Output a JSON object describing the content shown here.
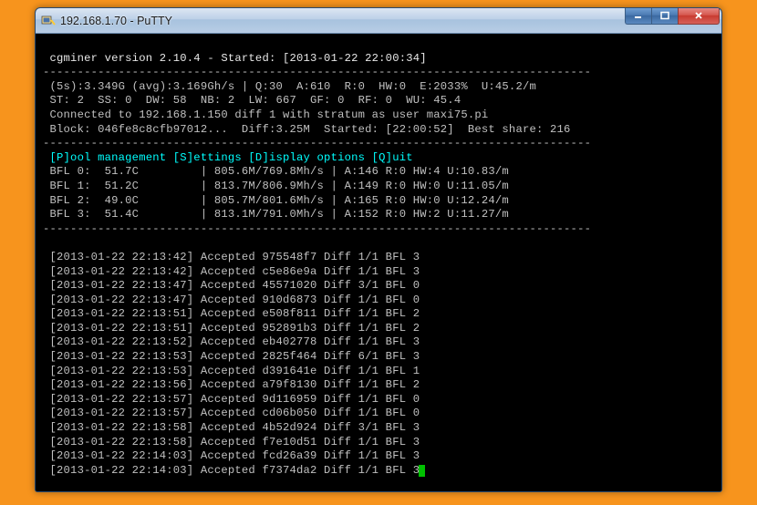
{
  "window": {
    "title": "192.168.1.70 - PuTTY"
  },
  "header": {
    "line": " cgminer version 2.10.4 - Started: [2013-01-22 22:00:34]"
  },
  "status": {
    "l1": " (5s):3.349G (avg):3.169Gh/s | Q:30  A:610  R:0  HW:0  E:2033%  U:45.2/m",
    "l2": " ST: 2  SS: 0  DW: 58  NB: 2  LW: 667  GF: 0  RF: 0  WU: 45.4",
    "l3": " Connected to 192.168.1.150 diff 1 with stratum as user maxi75.pi",
    "l4": " Block: 046fe8c8cfb97012...  Diff:3.25M  Started: [22:00:52]  Best share: 216"
  },
  "menu": " [P]ool management [S]ettings [D]isplay options [Q]uit",
  "devices": [
    " BFL 0:  51.7C         | 805.6M/769.8Mh/s | A:146 R:0 HW:4 U:10.83/m",
    " BFL 1:  51.2C         | 813.7M/806.9Mh/s | A:149 R:0 HW:0 U:11.05/m",
    " BFL 2:  49.0C         | 805.7M/801.6Mh/s | A:165 R:0 HW:0 U:12.24/m",
    " BFL 3:  51.4C         | 813.1M/791.0Mh/s | A:152 R:0 HW:2 U:11.27/m"
  ],
  "log": [
    " [2013-01-22 22:13:42] Accepted 975548f7 Diff 1/1 BFL 3",
    " [2013-01-22 22:13:42] Accepted c5e86e9a Diff 1/1 BFL 3",
    " [2013-01-22 22:13:47] Accepted 45571020 Diff 3/1 BFL 0",
    " [2013-01-22 22:13:47] Accepted 910d6873 Diff 1/1 BFL 0",
    " [2013-01-22 22:13:51] Accepted e508f811 Diff 1/1 BFL 2",
    " [2013-01-22 22:13:51] Accepted 952891b3 Diff 1/1 BFL 2",
    " [2013-01-22 22:13:52] Accepted eb402778 Diff 1/1 BFL 3",
    " [2013-01-22 22:13:53] Accepted 2825f464 Diff 6/1 BFL 3",
    " [2013-01-22 22:13:53] Accepted d391641e Diff 1/1 BFL 1",
    " [2013-01-22 22:13:56] Accepted a79f8130 Diff 1/1 BFL 2",
    " [2013-01-22 22:13:57] Accepted 9d116959 Diff 1/1 BFL 0",
    " [2013-01-22 22:13:57] Accepted cd06b050 Diff 1/1 BFL 0",
    " [2013-01-22 22:13:58] Accepted 4b52d924 Diff 3/1 BFL 3",
    " [2013-01-22 22:13:58] Accepted f7e10d51 Diff 1/1 BFL 3",
    " [2013-01-22 22:14:03] Accepted fcd26a39 Diff 1/1 BFL 3",
    " [2013-01-22 22:14:03] Accepted f7374da2 Diff 1/1 BFL 3"
  ],
  "hr": "--------------------------------------------------------------------------------"
}
